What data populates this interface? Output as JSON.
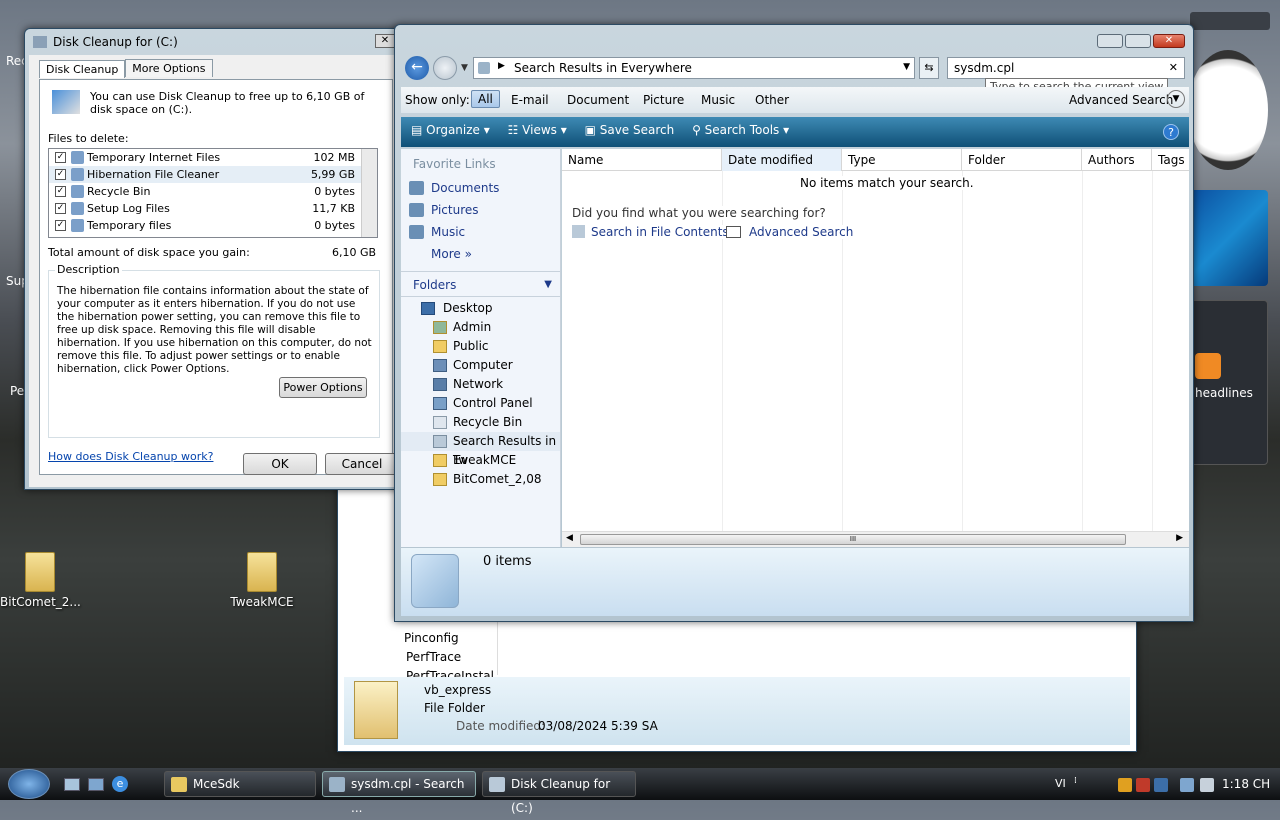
{
  "desktop": {
    "icons": [
      {
        "label": "BitComet_2..."
      },
      {
        "label": "TweakMCE"
      }
    ],
    "partial_labels": [
      "Rec",
      "Sup",
      "Pe"
    ],
    "headlines": "headlines"
  },
  "disk_cleanup": {
    "title": "Disk Cleanup for  (C:)",
    "tabs": [
      "Disk Cleanup",
      "More Options"
    ],
    "intro": "You can use Disk Cleanup to free up to 6,10 GB of disk space on  (C:).",
    "files_label": "Files to delete:",
    "files": [
      {
        "name": "Temporary Internet Files",
        "size": "102 MB",
        "checked": "✓"
      },
      {
        "name": "Hibernation File Cleaner",
        "size": "5,99 GB",
        "checked": "✓"
      },
      {
        "name": "Recycle Bin",
        "size": "0 bytes",
        "checked": "✓"
      },
      {
        "name": "Setup Log Files",
        "size": "11,7 KB",
        "checked": "✓"
      },
      {
        "name": "Temporary files",
        "size": "0 bytes",
        "checked": "✓"
      }
    ],
    "total_label": "Total amount of disk space you gain:",
    "total_value": "6,10 GB",
    "description_label": "Description",
    "description": "The hibernation file contains information about the state of your computer as it enters hibernation. If you do not use the hibernation power setting, you can remove this file to free up disk space. Removing this file will disable hibernation. If you use hibernation on this computer, do not remove this file. To adjust power settings or to enable hibernation, click Power Options.",
    "power_options": "Power Options",
    "help_link": "How does Disk Cleanup work?",
    "ok": "OK",
    "cancel": "Cancel"
  },
  "search": {
    "address": "Search Results in Everywhere",
    "query": "sysdm.cpl",
    "tooltip": "Type to search the current view",
    "show_only": "Show only:",
    "filters": [
      "All",
      "E-mail",
      "Document",
      "Picture",
      "Music",
      "Other"
    ],
    "advanced": "Advanced Search",
    "toolbar": {
      "organize": "Organize",
      "views": "Views",
      "save": "Save Search",
      "tools": "Search Tools"
    },
    "favorite_links": "Favorite Links",
    "links": [
      "Documents",
      "Pictures",
      "Music"
    ],
    "more": "More",
    "folders": "Folders",
    "tree": [
      "Desktop",
      "Admin",
      "Public",
      "Computer",
      "Network",
      "Control Panel",
      "Recycle Bin",
      "Search Results in Ev",
      "TweakMCE",
      "BitComet_2,08"
    ],
    "columns": [
      "Name",
      "Date modified",
      "Type",
      "Folder",
      "Authors",
      "Tags"
    ],
    "no_items": "No items match your search.",
    "did_you_find": "Did you find what you were searching for?",
    "search_contents": "Search in File Contents",
    "adv_search": "Advanced Search",
    "status": "0 items",
    "scroll_grip": "III"
  },
  "back_window": {
    "items": [
      "Pinconfig",
      "PerfTrace",
      "PerfTraceInstal"
    ],
    "detail_name": "vb_express",
    "detail_type": "File Folder",
    "detail_date_label": "Date modified:",
    "detail_date": "03/08/2024 5:39 SA"
  },
  "taskbar": {
    "tasks": [
      "MceSdk",
      "sysdm.cpl - Search ...",
      "Disk Cleanup for  (C:)"
    ],
    "lang": "VI",
    "time": "1:18 CH"
  }
}
